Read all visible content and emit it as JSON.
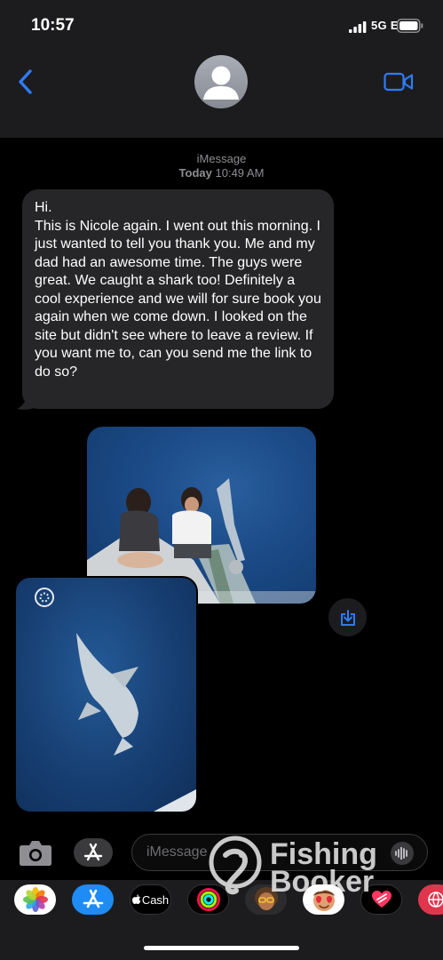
{
  "status_bar": {
    "time": "10:57",
    "network": "5G E"
  },
  "header": {
    "back_icon": "chevron-left-icon",
    "video_icon": "video-camera-icon",
    "accent_color": "#2f7bf6"
  },
  "conversation": {
    "service": "iMessage",
    "date_day": "Today",
    "date_time": "10:49 AM",
    "message_text": "Hi.\nThis is Nicole again. I went out this morning. I just wanted to tell you thank you. Me and my dad had an awesome time. The guys were great. We caught a shark too! Definitely a cool experience and we will for sure book you again when we come down. I looked on the site but didn't see where to leave a review. If you want me to, can you send me the link to do so?",
    "photos": [
      "photo-two-people-on-boat",
      "photo-shark-in-water"
    ]
  },
  "input_bar": {
    "placeholder": "iMessage"
  },
  "app_drawer": {
    "apps": [
      {
        "name": "Photos",
        "icon": "photos-icon"
      },
      {
        "name": "App Store",
        "icon": "app-store-icon"
      },
      {
        "name": "Cash",
        "label": "Cash",
        "icon": "apple-cash-icon"
      },
      {
        "name": "Activity",
        "icon": "activity-rings-icon"
      },
      {
        "name": "Memoji",
        "icon": "memoji-icon"
      },
      {
        "name": "Memoji Stickers",
        "icon": "memoji-stickers-icon"
      },
      {
        "name": "Digital Touch",
        "icon": "digital-touch-icon"
      },
      {
        "name": "Web",
        "icon": "globe-icon"
      }
    ]
  },
  "watermark": {
    "line1": "Fishing",
    "line2": "Booker"
  }
}
